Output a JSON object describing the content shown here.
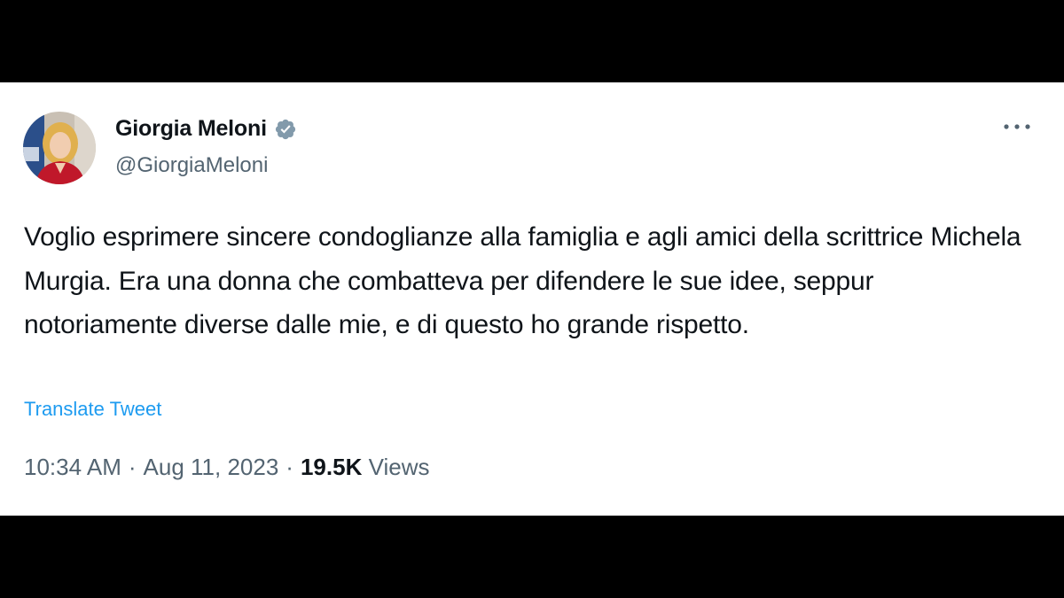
{
  "colors": {
    "text_primary": "#0f1419",
    "text_secondary": "#536471",
    "link": "#1d9bf0",
    "verified_badge": "#829aab",
    "background": "#ffffff",
    "frame": "#000000"
  },
  "author": {
    "display_name": "Giorgia Meloni",
    "handle": "@GiorgiaMeloni",
    "verified": true,
    "verified_icon": "verified-badge-icon",
    "avatar_icon": "profile-photo"
  },
  "menu": {
    "icon": "more-horizontal-icon"
  },
  "tweet": {
    "text": "Voglio esprimere sincere condoglianze alla famiglia e agli amici della scrittrice Michela Murgia. Era una donna che combatteva per difendere le sue idee, seppur notoriamente diverse dalle mie, e di questo ho grande rispetto.",
    "translate_label": "Translate Tweet"
  },
  "meta": {
    "time": "10:34 AM",
    "separator": "·",
    "date": "Aug 11, 2023",
    "views_count": "19.5K",
    "views_label": "Views"
  }
}
